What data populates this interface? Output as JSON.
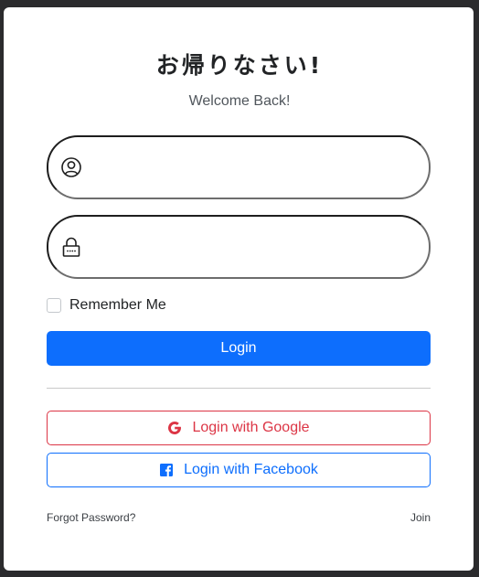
{
  "header": {
    "title": "お帰りなさい!",
    "subtitle": "Welcome Back!"
  },
  "form": {
    "username": {
      "value": "",
      "placeholder": "",
      "icon": "user-icon"
    },
    "password": {
      "value": "",
      "placeholder": "",
      "icon": "lock-icon"
    },
    "remember": {
      "label": "Remember Me",
      "checked": false
    },
    "login_label": "Login"
  },
  "social": {
    "google_label": "Login with Google",
    "google_icon": "google-icon",
    "google_color": "#dc3545",
    "facebook_label": "Login with Facebook",
    "facebook_icon": "facebook-icon",
    "facebook_color": "#0d6efd"
  },
  "footer": {
    "forgot_label": "Forgot Password?",
    "join_label": "Join"
  },
  "colors": {
    "accent": "#0d6efd",
    "background": "#2b2b2d",
    "card": "#ffffff"
  }
}
